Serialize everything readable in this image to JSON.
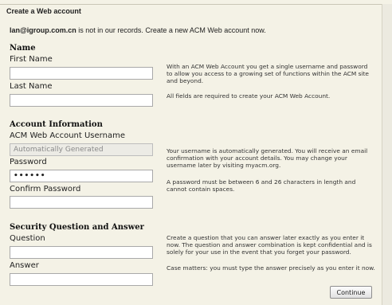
{
  "panel": {
    "title": "Create a Web account"
  },
  "notice": {
    "email": "lan@igroup.com.cn",
    "message": " is not in our records. Create a new ACM Web account now."
  },
  "name_section": {
    "heading": "Name",
    "first_name_label": "First Name",
    "first_name_value": "",
    "last_name_label": "Last Name",
    "last_name_value": "",
    "help_1": "With an ACM Web Account you get a single username and password to allow you access to a growing set of functions within the ACM site and beyond.",
    "help_2": "All fields are required to create your ACM Web Account."
  },
  "account_section": {
    "heading": "Account Information",
    "username_label": "ACM Web Account Username",
    "username_value": "Automatically Generated",
    "password_label": "Password",
    "password_value": "••••••",
    "confirm_label": "Confirm Password",
    "confirm_value": "",
    "help_1": "Your username is automatically generated. You will receive an email confirmation with your account details. You may change your username later by visiting myacm.org.",
    "help_2": "A password must be between 6 and 26 characters in length and cannot contain spaces."
  },
  "security_section": {
    "heading": "Security Question and Answer",
    "question_label": "Question",
    "question_value": "",
    "answer_label": "Answer",
    "answer_value": "",
    "help_1": "Create a question that you can answer later exactly as you enter it now. The question and answer combination is kept confidential and is solely for your use in the event that you forget your password.",
    "help_2": "Case matters: you must type the answer precisely as you enter it now."
  },
  "actions": {
    "continue_label": "Continue"
  }
}
